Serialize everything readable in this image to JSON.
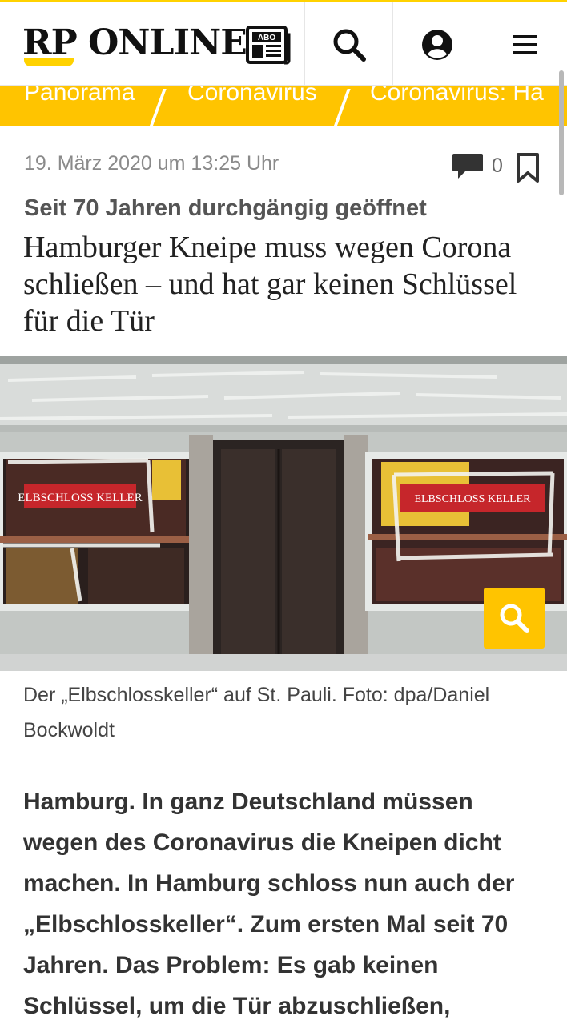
{
  "header": {
    "logo_text": "RP ONLINE",
    "abo_label": "ABO",
    "icons": [
      "newspaper-abo-icon",
      "search-icon",
      "user-icon",
      "menu-icon"
    ]
  },
  "breadcrumb": {
    "items": [
      "Panorama",
      "Coronavirus",
      "Coronavirus: Ha"
    ]
  },
  "article": {
    "date": "19. März 2020 um 13:25 Uhr",
    "comment_count": "0",
    "kicker": "Seit 70 Jahren durchgängig geöffnet",
    "headline": "Hamburger Kneipe muss wegen Corona schließen – und hat gar keinen Schlüssel für die Tür",
    "image_sign_text": "ELBSCHLOSS KELLER",
    "caption": "Der „Elbschlosskeller“ auf St. Pauli. Foto: dpa/Daniel Bockwoldt",
    "body": "Hamburg.  In ganz Deutschland müssen wegen des Coronavirus die Kneipen dicht machen. In Hamburg schloss nun auch der „Elbschlosskeller“. Zum ersten Mal seit 70 Jahren. Das Problem: Es gab keinen Schlüssel, um die Tür abzuschließen,"
  },
  "colors": {
    "brand_yellow": "#ffc400",
    "text_dark": "#222222",
    "meta_grey": "#8a8a8a"
  }
}
